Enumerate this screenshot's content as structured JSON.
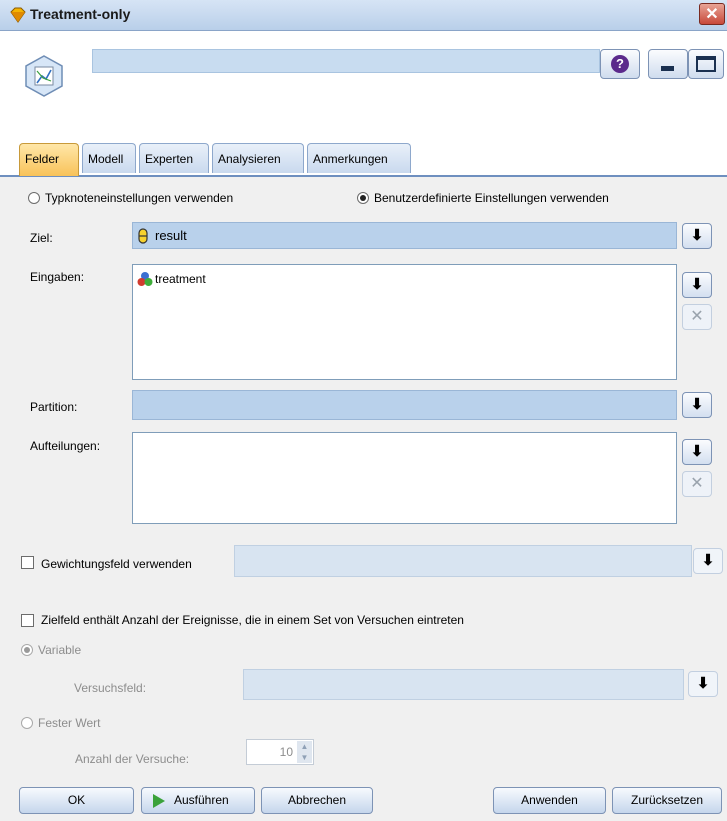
{
  "window": {
    "title": "Treatment-only",
    "close_glyph": "✕"
  },
  "header": {
    "name_field_value": "",
    "help_glyph": "?"
  },
  "tabs": [
    {
      "label": "Felder",
      "active": true
    },
    {
      "label": "Modell",
      "active": false
    },
    {
      "label": "Experten",
      "active": false
    },
    {
      "label": "Analysieren",
      "active": false
    },
    {
      "label": "Anmerkungen",
      "active": false
    }
  ],
  "settings": {
    "option_type_node": "Typknoteneinstellungen verwenden",
    "option_custom": "Benutzerdefinierte Einstellungen verwenden",
    "selected": "custom"
  },
  "fields": {
    "target_label": "Ziel:",
    "target_value": "result",
    "inputs_label": "Eingaben:",
    "inputs": [
      "treatment"
    ],
    "partition_label": "Partition:",
    "partition_value": "",
    "splits_label": "Aufteilungen:",
    "splits": [],
    "weight_label": "Gewichtungsfeld verwenden",
    "weight_checked": false,
    "events_label": "Zielfeld enthält Anzahl der Ereignisse, die in einem Set von Versuchen eintreten",
    "events_checked": false,
    "variable_label": "Variable",
    "trials_field_label": "Versuchsfeld:",
    "fixed_value_label": "Fester Wert",
    "num_trials_label": "Anzahl der Versuche:",
    "num_trials_value": "10"
  },
  "buttons": {
    "ok": "OK",
    "run": "Ausführen",
    "cancel": "Abbrechen",
    "apply": "Anwenden",
    "reset": "Zurücksetzen"
  },
  "colors": {
    "accent_tab": "#f8c259",
    "field_blue": "#b9d1eb",
    "close_red": "#c8493a"
  }
}
